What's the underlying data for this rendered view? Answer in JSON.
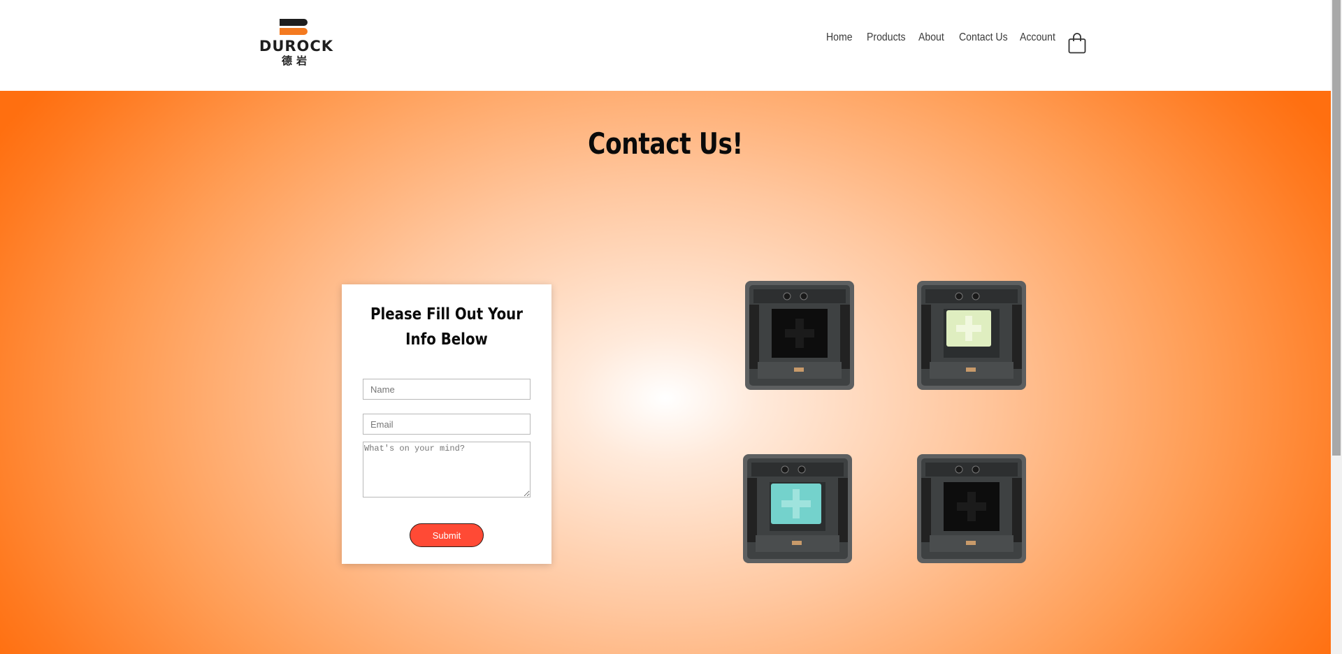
{
  "header": {
    "logo": {
      "wordmark": "DUROCK",
      "subtitle": "德岩",
      "brand_colors": {
        "dark": "#1e1e1e",
        "accent": "#f47a20"
      }
    },
    "nav": [
      {
        "label": "Home"
      },
      {
        "label": "Products"
      },
      {
        "label": "About"
      },
      {
        "label": "Contact Us"
      },
      {
        "label": "Account"
      }
    ],
    "cart_icon": "shopping-bag-icon"
  },
  "hero": {
    "title": "Contact Us!",
    "background_colors": {
      "center": "#ffffff",
      "edge": "#ff6f10"
    }
  },
  "form": {
    "title": "Please Fill Out Your Info Below",
    "name_placeholder": "Name",
    "email_placeholder": "Email",
    "message_placeholder": "What's on your mind?",
    "submit_label": "Submit",
    "submit_color": "#ff4a35"
  },
  "products_gallery": [
    {
      "icon": "mechanical-switch-black-icon",
      "stem_color": "#0d0d0d"
    },
    {
      "icon": "mechanical-switch-lime-icon",
      "stem_color": "#dfeec0"
    },
    {
      "icon": "mechanical-switch-teal-icon",
      "stem_color": "#74d2cc"
    },
    {
      "icon": "mechanical-switch-black-icon",
      "stem_color": "#0d0d0d"
    }
  ]
}
